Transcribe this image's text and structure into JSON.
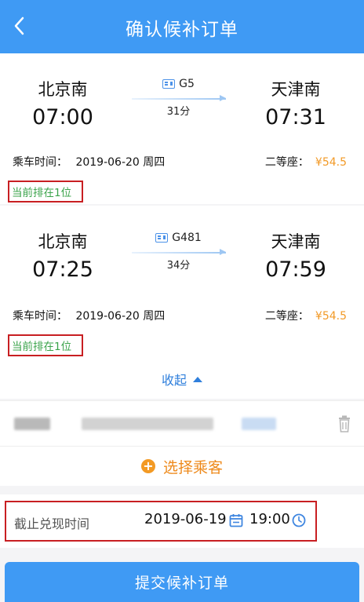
{
  "header": {
    "title": "确认候补订单"
  },
  "trains": [
    {
      "from_station": "北京南",
      "from_time": "07:00",
      "train_no": "G5",
      "duration": "31分",
      "to_station": "天津南",
      "to_time": "07:31",
      "ride_time_label": "乘车时间：",
      "ride_date": "2019-06-20 周四",
      "seat_label": "二等座：",
      "price": "¥54.5",
      "queue_status": "当前排在1位"
    },
    {
      "from_station": "北京南",
      "from_time": "07:25",
      "train_no": "G481",
      "duration": "34分",
      "to_station": "天津南",
      "to_time": "07:59",
      "ride_time_label": "乘车时间：",
      "ride_date": "2019-06-20 周四",
      "seat_label": "二等座：",
      "price": "¥54.5",
      "queue_status": "当前排在1位"
    }
  ],
  "collapse_label": "收起",
  "select_passenger_label": "选择乘客",
  "deadline": {
    "label": "截止兑现时间",
    "date": "2019-06-19",
    "time": "19:00"
  },
  "submit_label": "提交候补订单",
  "colors": {
    "primary": "#3f9af4",
    "price": "#f29a27",
    "queue": "#3aa34a",
    "highlight_border": "#c81f22",
    "action_orange": "#ee8a1c"
  }
}
